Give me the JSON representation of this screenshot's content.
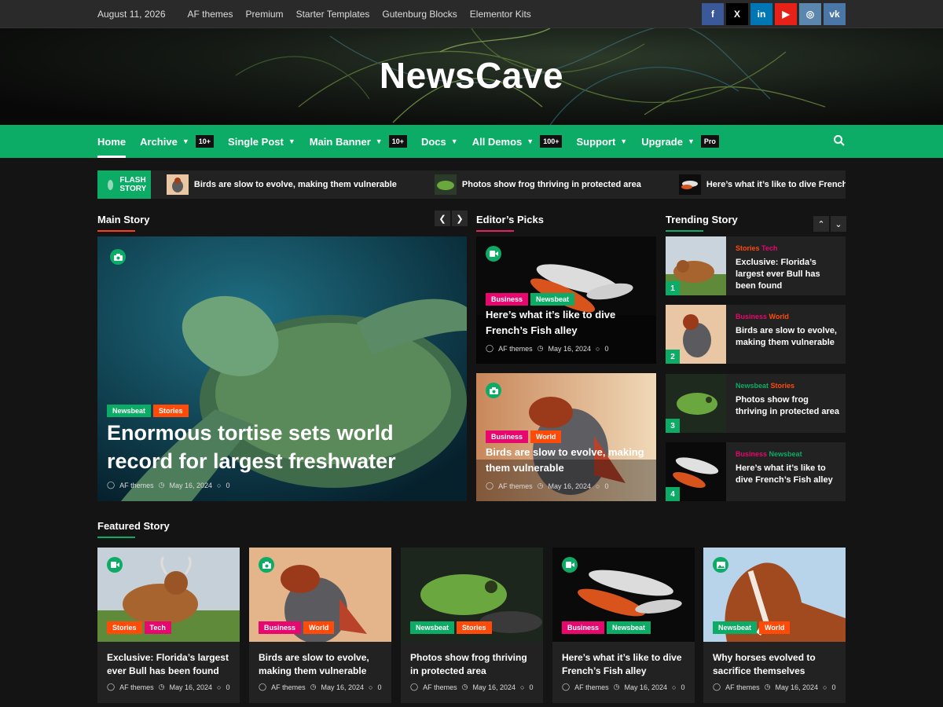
{
  "topbar": {
    "date": "August 11, 2026",
    "links": [
      "AF themes",
      "Premium",
      "Starter Templates",
      "Gutenburg Blocks",
      "Elementor Kits"
    ],
    "socials": [
      {
        "icon": "facebook-icon",
        "glyph": "f",
        "color": "#3b5998"
      },
      {
        "icon": "x-icon",
        "glyph": "X",
        "color": "#000000"
      },
      {
        "icon": "linkedin-icon",
        "glyph": "in",
        "color": "#0077b5"
      },
      {
        "icon": "youtube-icon",
        "glyph": "▶",
        "color": "#e62117"
      },
      {
        "icon": "instagram-icon",
        "glyph": "◎",
        "color": "#5b86ad"
      },
      {
        "icon": "vk-icon",
        "glyph": "vk",
        "color": "#4a76a8"
      }
    ]
  },
  "site": {
    "title": "NewsCave"
  },
  "nav": {
    "items": [
      {
        "label": "Home",
        "active": true
      },
      {
        "label": "Archive",
        "badge": "10+"
      },
      {
        "label": "Single Post"
      },
      {
        "label": "Main Banner",
        "badge": "10+"
      },
      {
        "label": "Docs"
      },
      {
        "label": "All Demos",
        "badge": "100+"
      },
      {
        "label": "Support"
      },
      {
        "label": "Upgrade",
        "badge": "Pro"
      }
    ],
    "search_icon": "search-icon"
  },
  "flash": {
    "label": "FLASH STORY",
    "items": [
      "Birds are slow to evolve, making them vulnerable",
      "Photos show frog thriving in protected area",
      "Here’s what it’s like to dive French’s"
    ]
  },
  "main_story": {
    "section_title": "Main Story",
    "categories": [
      "Newsbeat",
      "Stories"
    ],
    "title": "Enormous tortise sets world record for largest freshwater",
    "author": "AF themes",
    "date": "May 16, 2024",
    "comments": "0"
  },
  "editors_picks": {
    "section_title": "Editor’s Picks",
    "posts": [
      {
        "categories": [
          "Business",
          "Newsbeat"
        ],
        "title": "Here’s what it’s like to dive French’s Fish alley",
        "author": "AF themes",
        "date": "May 16, 2024",
        "comments": "0"
      },
      {
        "categories": [
          "Business",
          "World"
        ],
        "title": "Birds are slow to evolve, making them vulnerable",
        "author": "AF themes",
        "date": "May 16, 2024",
        "comments": "0"
      }
    ]
  },
  "trending": {
    "section_title": "Trending Story",
    "posts": [
      {
        "num": "1",
        "categories": [
          "Stories",
          "Tech"
        ],
        "title": "Exclusive: Florida’s largest ever Bull has been found"
      },
      {
        "num": "2",
        "categories": [
          "Business",
          "World"
        ],
        "title": "Birds are slow to evolve, making them vulnerable"
      },
      {
        "num": "3",
        "categories": [
          "Newsbeat",
          "Stories"
        ],
        "title": "Photos show frog thriving in protected area"
      },
      {
        "num": "4",
        "categories": [
          "Business",
          "Newsbeat"
        ],
        "title": "Here’s what it’s like to dive French’s Fish alley"
      }
    ]
  },
  "featured": {
    "section_title": "Featured Story",
    "posts": [
      {
        "categories": [
          "Stories",
          "Tech"
        ],
        "title": "Exclusive: Florida’s largest ever Bull has been found",
        "author": "AF themes",
        "date": "May 16, 2024",
        "comments": "0",
        "icon": "video-icon"
      },
      {
        "categories": [
          "Business",
          "World"
        ],
        "title": "Birds are slow to evolve, making them vulnerable",
        "author": "AF themes",
        "date": "May 16, 2024",
        "comments": "0",
        "icon": "camera-icon"
      },
      {
        "categories": [
          "Newsbeat",
          "Stories"
        ],
        "title": "Photos show frog thriving in protected area",
        "author": "AF themes",
        "date": "May 16, 2024",
        "comments": "0",
        "icon": ""
      },
      {
        "categories": [
          "Business",
          "Newsbeat"
        ],
        "title": "Here’s what it’s like to dive French’s Fish alley",
        "author": "AF themes",
        "date": "May 16, 2024",
        "comments": "0",
        "icon": "video-icon"
      },
      {
        "categories": [
          "Newsbeat",
          "World"
        ],
        "title": "Why horses evolved to sacrifice themselves",
        "author": "AF themes",
        "date": "May 16, 2024",
        "comments": "0",
        "icon": "image-icon"
      }
    ]
  },
  "colors": {
    "accent": "#0cab66",
    "newsbeat": "#0cab66",
    "orange": "#ff4b0a",
    "pink": "#e6086f"
  }
}
